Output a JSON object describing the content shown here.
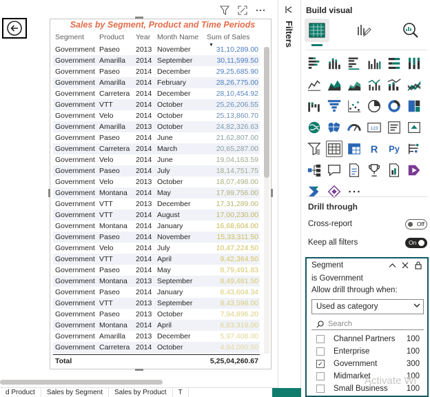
{
  "table": {
    "title": "Sales by Segment, Product and Time Periods",
    "headers": [
      "Segment",
      "Product",
      "Year",
      "Month Name",
      "Sum of Sales"
    ],
    "rows": [
      [
        "Government",
        "Paseo",
        "2013",
        "November",
        "31,10,289.00"
      ],
      [
        "Government",
        "Amarilla",
        "2014",
        "September",
        "30,11,599.50"
      ],
      [
        "Government",
        "Paseo",
        "2014",
        "December",
        "29,25,685.90"
      ],
      [
        "Government",
        "Amarilla",
        "2014",
        "February",
        "28,26,775.00"
      ],
      [
        "Government",
        "Carretera",
        "2014",
        "December",
        "28,10,454.92"
      ],
      [
        "Government",
        "VTT",
        "2014",
        "October",
        "25,26,206.55"
      ],
      [
        "Government",
        "Velo",
        "2014",
        "October",
        "25,13,860.70"
      ],
      [
        "Government",
        "Amarilla",
        "2013",
        "October",
        "24,82,326.63"
      ],
      [
        "Government",
        "Paseo",
        "2014",
        "June",
        "21,62,807.00"
      ],
      [
        "Government",
        "Carretera",
        "2014",
        "March",
        "20,65,287.00"
      ],
      [
        "Government",
        "Velo",
        "2014",
        "June",
        "19,04,163.59"
      ],
      [
        "Government",
        "Paseo",
        "2014",
        "July",
        "18,14,751.75"
      ],
      [
        "Government",
        "Velo",
        "2013",
        "October",
        "18,07,498.00"
      ],
      [
        "Government",
        "Montana",
        "2014",
        "May",
        "17,99,756.00"
      ],
      [
        "Government",
        "VTT",
        "2013",
        "December",
        "17,31,289.00"
      ],
      [
        "Government",
        "VTT",
        "2014",
        "August",
        "17,00,230.00"
      ],
      [
        "Government",
        "Montana",
        "2014",
        "January",
        "16,68,604.00"
      ],
      [
        "Government",
        "Paseo",
        "2014",
        "November",
        "15,33,311.50"
      ],
      [
        "Government",
        "Velo",
        "2014",
        "July",
        "10,47,224.50"
      ],
      [
        "Government",
        "VTT",
        "2014",
        "April",
        "9,42,364.50"
      ],
      [
        "Government",
        "Paseo",
        "2014",
        "May",
        "8,79,491.83"
      ],
      [
        "Government",
        "Montana",
        "2013",
        "September",
        "8,49,481.50"
      ],
      [
        "Government",
        "Paseo",
        "2014",
        "January",
        "8,43,604.34"
      ],
      [
        "Government",
        "VTT",
        "2013",
        "September",
        "8,43,598.00"
      ],
      [
        "Government",
        "Paseo",
        "2013",
        "October",
        "7,94,896.20"
      ],
      [
        "Government",
        "Montana",
        "2014",
        "April",
        "6,83,319.00"
      ],
      [
        "Government",
        "Amarilla",
        "2013",
        "December",
        "5,97,408.00"
      ],
      [
        "Government",
        "Carretera",
        "2014",
        "October",
        "4,84,060.50"
      ]
    ],
    "value_colors": [
      "#4a7cc0",
      "#4a7cc0",
      "#4a7cc0",
      "#4a7cc0",
      "#5a86bc",
      "#6a8fb6",
      "#6a8fb6",
      "#7d98ac",
      "#8a9fa4",
      "#8a9fa4",
      "#9ea890",
      "#9ea890",
      "#a9ad80",
      "#b2b176",
      "#b9b56c",
      "#c2b560",
      "#c8b855",
      "#cbbc59",
      "#d1bf59",
      "#d4c35c",
      "#d6c764",
      "#d8c96c",
      "#d8cb72",
      "#dacd79",
      "#dccf80",
      "#ded289",
      "#e0d493",
      "#e2d79b"
    ],
    "total_label": "Total",
    "total_value": "5,25,04,260.67"
  },
  "page_tabs": [
    "d Product",
    "Sales by Segment",
    "Sales by Product",
    "T"
  ],
  "filters": {
    "label": "Filters"
  },
  "viz": {
    "title": "Build visual",
    "icons": [
      "stacked-bar-chart-icon",
      "stacked-column-chart-icon",
      "clustered-bar-chart-icon",
      "clustered-column-chart-icon",
      "100-stacked-bar-chart-icon",
      "100-stacked-column-chart-icon",
      "line-chart-icon",
      "area-chart-icon",
      "stacked-area-chart-icon",
      "line-clustered-column-icon",
      "line-stacked-column-icon",
      "ribbon-chart-icon",
      "waterfall-chart-icon",
      "funnel-chart-icon",
      "scatter-chart-icon",
      "pie-chart-icon",
      "donut-chart-icon",
      "treemap-icon",
      "map-icon",
      "filled-map-icon",
      "gauge-icon",
      "card-icon",
      "multi-row-card-icon",
      "kpi-icon",
      "slicer-icon",
      "table-icon",
      "matrix-icon",
      "r-visual-icon",
      "python-visual-icon",
      "key-influencers-icon",
      "decomposition-tree-icon",
      "qna-icon",
      "smart-narrative-icon",
      "goals-icon",
      "paginated-report-icon",
      "power-apps-icon",
      "power-automate-icon",
      "more-visuals-icon",
      "ellipsis-icon"
    ],
    "selected_icon": "table-icon"
  },
  "drill": {
    "title": "Drill through",
    "cross_report_label": "Cross-report",
    "cross_report_state": "Off",
    "keep_filters_label": "Keep all filters",
    "keep_filters_state": "On",
    "field": "Segment",
    "condition": "is Government",
    "allow_label": "Allow drill through when:",
    "select_value": "Used as category",
    "search_placeholder": "Search",
    "items": [
      {
        "label": "Channel Partners",
        "count": "100",
        "checked": false
      },
      {
        "label": "Enterprise",
        "count": "100",
        "checked": false
      },
      {
        "label": "Government",
        "count": "300",
        "checked": true
      },
      {
        "label": "Midmarket",
        "count": "100",
        "checked": false
      },
      {
        "label": "Small Business",
        "count": "100",
        "checked": false
      }
    ],
    "watermark": "Activate Wi"
  },
  "colors": {
    "accent": "#0f7c6c",
    "title": "#e46c4a"
  }
}
